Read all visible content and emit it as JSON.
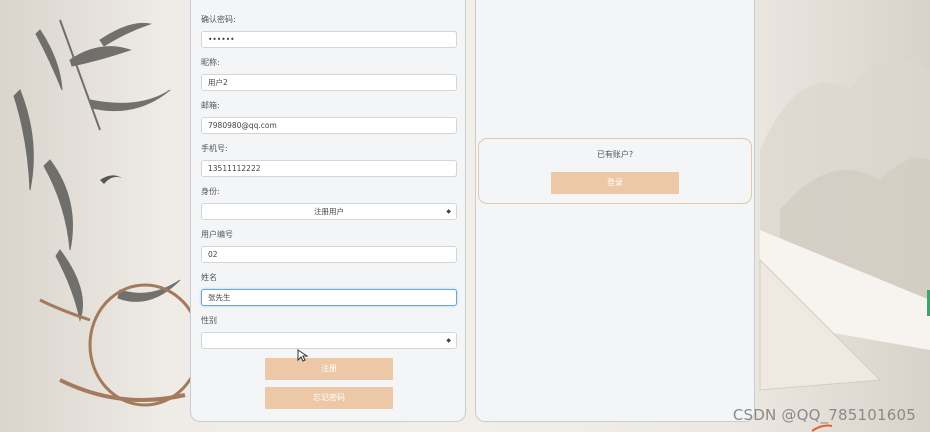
{
  "register_form": {
    "confirm_password": {
      "label": "确认密码:",
      "value": "••••••"
    },
    "nickname": {
      "label": "昵称:",
      "value": "用户2"
    },
    "email": {
      "label": "邮箱:",
      "value": "7980980@qq.com"
    },
    "phone": {
      "label": "手机号:",
      "value": "13511112222"
    },
    "role": {
      "label": "身份:",
      "selected": "注册用户"
    },
    "user_id": {
      "label": "用户编号",
      "value": "02"
    },
    "name": {
      "label": "姓名",
      "value": "张先生"
    },
    "gender": {
      "label": "性别",
      "selected": ""
    },
    "register_button": "注册",
    "forgot_button": "忘记密码"
  },
  "login_panel": {
    "prompt": "已有账户?",
    "login_button": "登录"
  },
  "watermark": "CSDN @QQ_785101605",
  "icons": [
    "cursor-icon",
    "select-arrow-icon"
  ],
  "colors": {
    "button": "#ecc8a6",
    "focus_border": "#6da7dc",
    "panel_bg": "#f3f5f6"
  }
}
